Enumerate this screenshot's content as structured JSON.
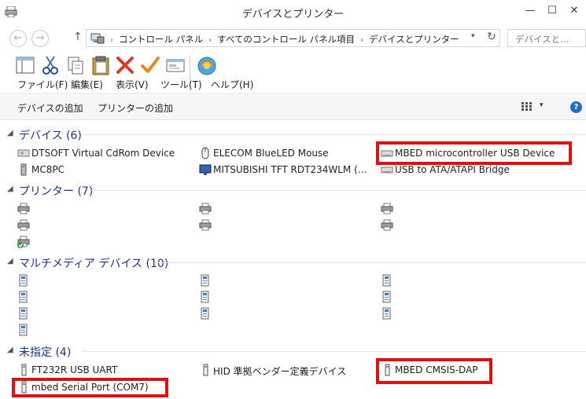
{
  "window": {
    "title": "デバイスとプリンター",
    "minimize_glyph": "—",
    "maximize_glyph": "☐",
    "close_glyph": "✕"
  },
  "address": {
    "back_glyph": "←",
    "forward_glyph": "→",
    "up_glyph": "↑",
    "crumbs": [
      "コントロール パネル",
      "すべてのコントロール パネル項目",
      "デバイスとプリンター"
    ],
    "separator": "›",
    "dropdown_glyph": "▾",
    "refresh_glyph": "↻",
    "search_placeholder": "デバイスと…"
  },
  "menu": {
    "file": "ファイル(F)",
    "edit": "編集(E)",
    "view": "表示(V)",
    "tools": "ツール(T)",
    "help": "ヘルプ(H)"
  },
  "commands": {
    "add_device": "デバイスの追加",
    "add_printer": "プリンターの追加",
    "view_dropdown_glyph": "▾",
    "help_glyph": "?"
  },
  "groups": {
    "devices": {
      "title": "デバイス (6)",
      "items": [
        "DTSOFT Virtual CdRom Device",
        "ELECOM BlueLED Mouse",
        "MBED microcontroller USB Device",
        "MC8PC",
        "MITSUBISHI TFT RDT234WLM (…",
        "USB to ATA/ATAPI Bridge"
      ]
    },
    "printers": {
      "title": "プリンター (7)"
    },
    "multimedia": {
      "title": "マルチメディア デバイス (10)"
    },
    "unspecified": {
      "title": "未指定 (4)",
      "items": [
        "FT232R USB UART",
        "HID 準拠ベンダー定義デバイス",
        "MBED CMSIS-DAP",
        "mbed Serial Port (COM7)"
      ]
    }
  },
  "colors": {
    "group_title": "#1e3287",
    "highlight": "#e01010",
    "group_line": "#dfe4ee",
    "command_bar": "#f5f6f7"
  }
}
